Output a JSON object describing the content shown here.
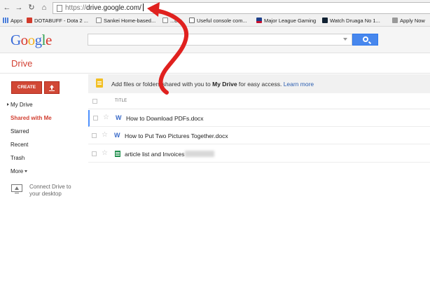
{
  "browser": {
    "url_scheme": "https://",
    "url_host": "drive.google.com/",
    "bookmarks": [
      {
        "label": "Apps",
        "icon": "apps-grid-icon"
      },
      {
        "label": "DOTABUFF - Dota 2 ...",
        "icon": "dotabuff-icon"
      },
      {
        "label": "Sankei Home-based...",
        "icon": "page-icon"
      },
      {
        "label": "...ork",
        "icon": "page-icon"
      },
      {
        "label": "Useful console com...",
        "icon": "t-icon"
      },
      {
        "label": "Major League Gaming",
        "icon": "mlg-icon"
      },
      {
        "label": "Watch Druaga No 1...",
        "icon": "anime-icon"
      },
      {
        "label": "Apply Now",
        "icon": "apple-icon"
      }
    ]
  },
  "google": {
    "logo_letters": [
      "G",
      "o",
      "o",
      "g",
      "l",
      "e"
    ],
    "search_value": ""
  },
  "drive": {
    "title": "Drive",
    "create_label": "CREATE",
    "sidebar": [
      {
        "label": "My Drive"
      },
      {
        "label": "Shared with Me"
      },
      {
        "label": "Starred"
      },
      {
        "label": "Recent"
      },
      {
        "label": "Trash"
      },
      {
        "label": "More"
      }
    ],
    "connect_line1": "Connect Drive to",
    "connect_line2": "your desktop",
    "notice": {
      "prefix": "Add files or folders shared with you to ",
      "bold": "My Drive",
      "suffix": " for easy access. ",
      "link": "Learn more"
    },
    "column_title": "TITLE",
    "files": [
      {
        "name": "How to Download PDFs.docx",
        "type": "word"
      },
      {
        "name": "How to Put Two Pictures Together.docx",
        "type": "word"
      },
      {
        "name": "article list and Invoices",
        "type": "sheet"
      }
    ]
  },
  "colors": {
    "annotation_red": "#e0211f",
    "drive_red": "#d23f31",
    "search_blue": "#4787ed"
  }
}
